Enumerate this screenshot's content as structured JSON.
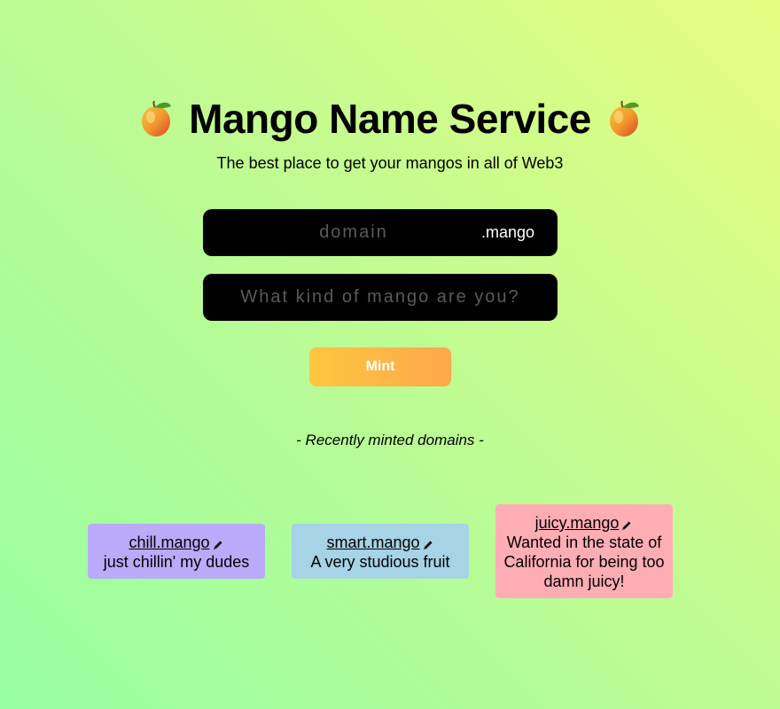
{
  "header": {
    "title": "Mango Name Service",
    "subtitle": "The best place to get your mangos in all of Web3",
    "left_icon": "mango-icon",
    "right_icon": "mango-icon"
  },
  "form": {
    "domain_placeholder": "domain",
    "domain_value": "",
    "tld": ".mango",
    "record_placeholder": "What kind of mango are you?",
    "record_value": "",
    "mint_label": "Mint"
  },
  "recent": {
    "heading": "- Recently minted domains -",
    "items": [
      {
        "name": "chill.mango",
        "record": "just chillin' my dudes",
        "color": "#baaafa",
        "icon": "pencil-icon"
      },
      {
        "name": "smart.mango",
        "record": "A very studious fruit",
        "color": "#a6d3e6",
        "icon": "pencil-icon"
      },
      {
        "name": "juicy.mango",
        "record": "Wanted in the state of California for being too damn juicy!",
        "color": "#ffadb5",
        "icon": "pencil-icon"
      }
    ]
  },
  "colors": {
    "mint_gradient_start": "#fdc640",
    "mint_gradient_end": "#fda84c",
    "input_background": "#000000"
  }
}
